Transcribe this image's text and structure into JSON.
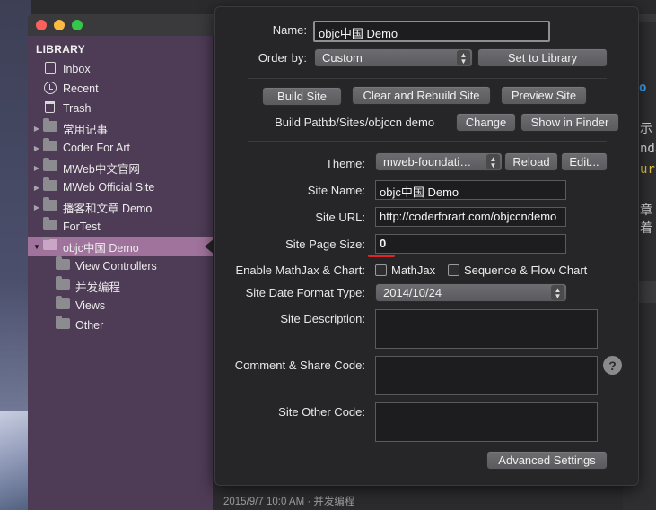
{
  "sidebar": {
    "header": "LIBRARY",
    "items": [
      {
        "label": "Inbox",
        "icon": "inbox-icon"
      },
      {
        "label": "Recent",
        "icon": "clock-icon"
      },
      {
        "label": "Trash",
        "icon": "trash-icon"
      },
      {
        "label": "常用记事",
        "icon": "folder-icon"
      },
      {
        "label": "Coder For Art",
        "icon": "folder-icon"
      },
      {
        "label": "MWeb中文官网",
        "icon": "folder-icon"
      },
      {
        "label": "MWeb Official Site",
        "icon": "folder-icon"
      },
      {
        "label": "播客和文章 Demo",
        "icon": "folder-icon"
      },
      {
        "label": "ForTest",
        "icon": "folder-icon"
      },
      {
        "label": "objc中国 Demo",
        "icon": "folder-icon",
        "selected": true
      },
      {
        "label": "View Controllers",
        "icon": "folder-icon"
      },
      {
        "label": "并发编程",
        "icon": "folder-icon"
      },
      {
        "label": "Views",
        "icon": "folder-icon"
      },
      {
        "label": "Other",
        "icon": "folder-icon"
      }
    ]
  },
  "editor": {
    "frag_o": "o",
    "frag_shi": "示",
    "frag_nda": "nda",
    "frag_ur": "ur",
    "frag_zhang": "章着",
    "status": "2015/9/7 10:0 AM  · 并发编程"
  },
  "sheet": {
    "name_label": "Name:",
    "name_value": "objc中国 Demo",
    "order_label": "Order by:",
    "order_value": "Custom",
    "set_library": "Set to Library",
    "build_site": "Build Site",
    "clear_rebuild": "Clear and Rebuild Site",
    "preview_site": "Preview Site",
    "build_path_label": "Build Path:",
    "build_path_value": "…b/Sites/objccn demo",
    "change": "Change",
    "show_finder": "Show in Finder",
    "theme_label": "Theme:",
    "theme_value": "mweb-foundati…",
    "reload": "Reload",
    "edit": "Edit...",
    "site_name_label": "Site Name:",
    "site_name_value": "objc中国 Demo",
    "site_url_label": "Site URL:",
    "site_url_value": "http://coderforart.com/objccndemo",
    "page_size_label": "Site Page Size:",
    "page_size_value": "0",
    "mathjax_label": "Enable MathJax & Chart:",
    "mathjax_check": "MathJax",
    "sequence_check": "Sequence & Flow Chart",
    "date_format_label": "Site Date Format Type:",
    "date_format_value": "2014/10/24",
    "desc_label": "Site Description:",
    "comment_label": "Comment & Share Code:",
    "other_label": "Site Other Code:",
    "help": "?",
    "advanced": "Advanced Settings"
  },
  "colors": {
    "sidebar_bg": "#4e3b55",
    "selected_row": "#a0739d",
    "accent_underline": "#e0242a"
  }
}
